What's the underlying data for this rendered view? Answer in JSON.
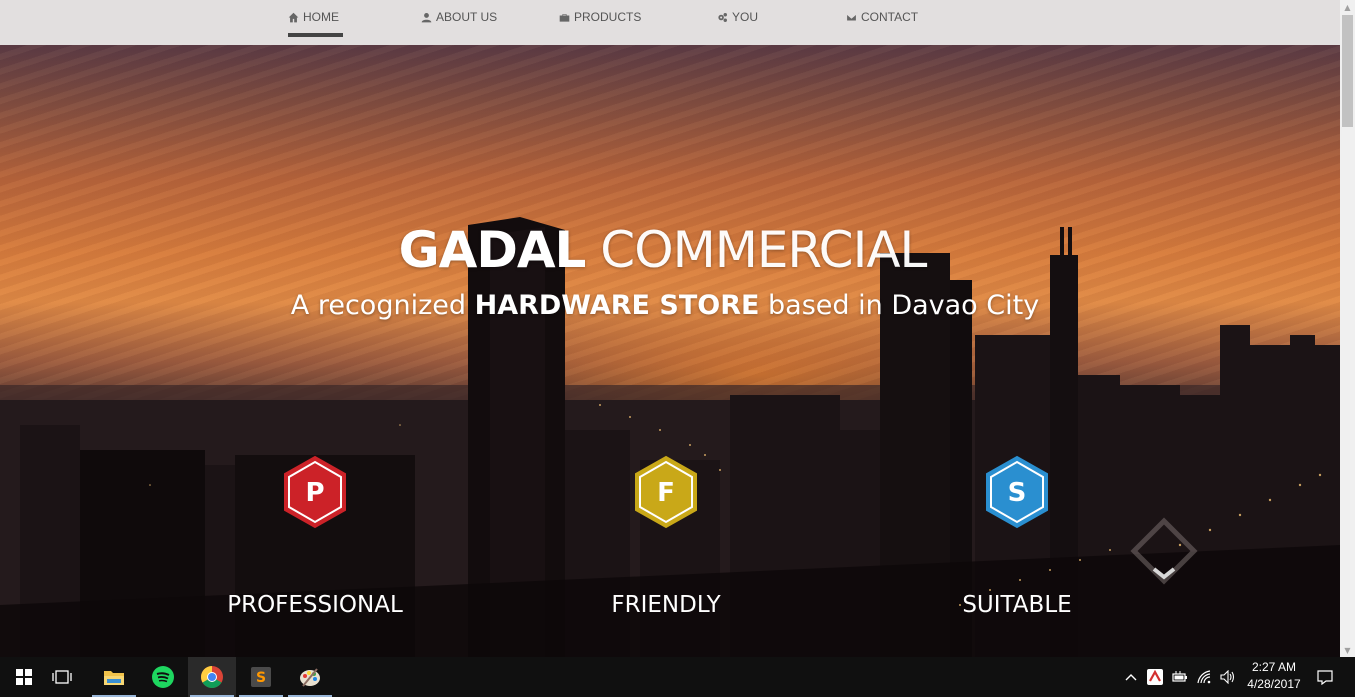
{
  "nav": {
    "items": [
      {
        "label": "HOME",
        "icon": "home-icon"
      },
      {
        "label": "ABOUT US",
        "icon": "user-icon"
      },
      {
        "label": "PRODUCTS",
        "icon": "briefcase-icon"
      },
      {
        "label": "YOU",
        "icon": "gears-icon"
      },
      {
        "label": "CONTACT",
        "icon": "envelope-icon"
      }
    ],
    "active": "HOME"
  },
  "hero": {
    "title_bold": "GADAL",
    "title_light": "COMMERCIAL",
    "subtitle_pre": "A recognized",
    "subtitle_bold": "HARDWARE STORE",
    "subtitle_post": "based in Davao City",
    "features": [
      {
        "letter": "P",
        "label": "PROFESSIONAL",
        "color": "#cc2228"
      },
      {
        "letter": "F",
        "label": "FRIENDLY",
        "color": "#c9a818"
      },
      {
        "letter": "S",
        "label": "SUITABLE",
        "color": "#2a8fd0"
      }
    ]
  },
  "taskbar": {
    "apps": [
      "windows-start",
      "task-view",
      "file-explorer",
      "spotify",
      "chrome",
      "sublime-text",
      "paint"
    ],
    "clock_time": "2:27 AM",
    "clock_date": "4/28/2017"
  },
  "colors": {
    "nav_bg": "#e2dfdf",
    "taskbar_bg": "#101010"
  }
}
